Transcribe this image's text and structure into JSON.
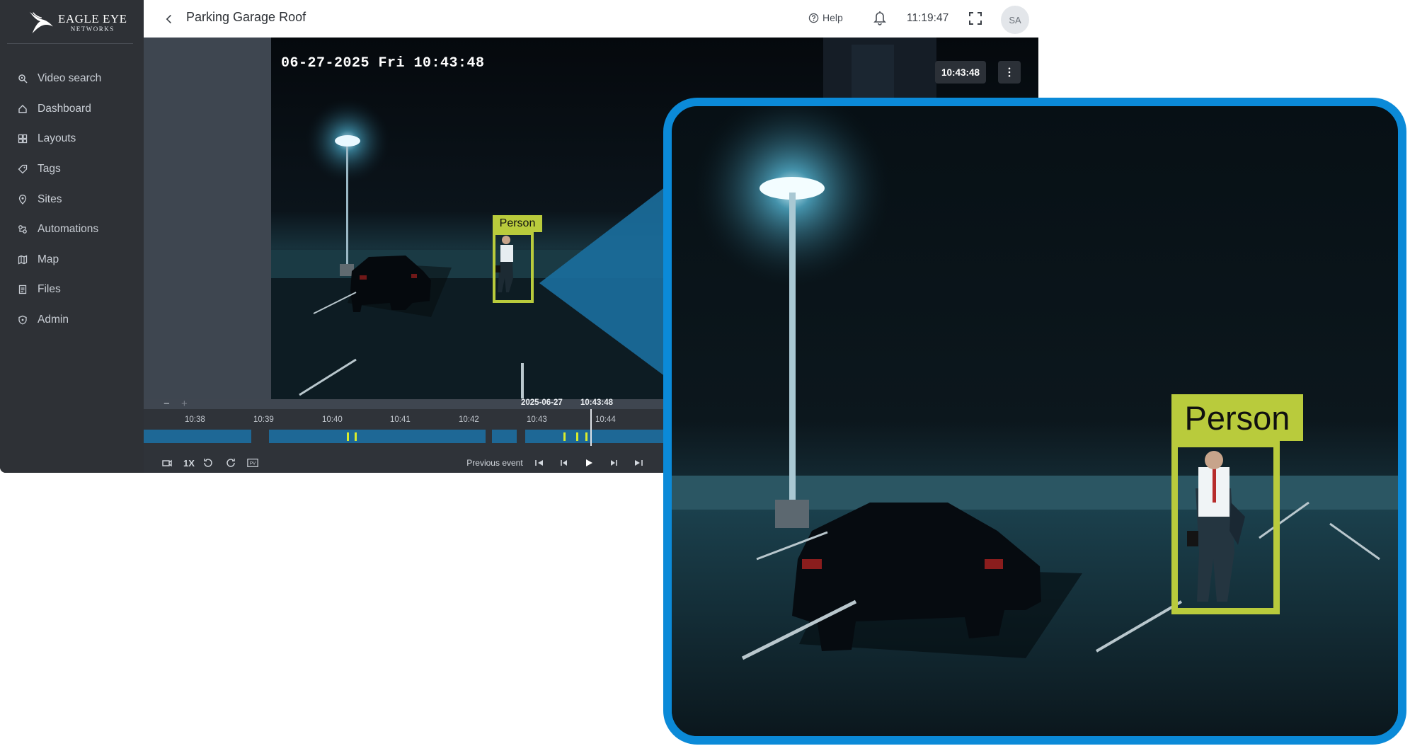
{
  "app": {
    "logo": {
      "main": "EAGLE EYE",
      "sub": "NETWORKS"
    },
    "camera_title": "Parking Garage Roof",
    "help_label": "Help",
    "clock": "11:19:47",
    "avatar_initials": "SA"
  },
  "sidebar": {
    "items": [
      {
        "label": "Video search",
        "icon": "search-icon"
      },
      {
        "label": "Dashboard",
        "icon": "home-icon"
      },
      {
        "label": "Layouts",
        "icon": "layouts-icon"
      },
      {
        "label": "Tags",
        "icon": "tag-icon"
      },
      {
        "label": "Sites",
        "icon": "location-pin-icon"
      },
      {
        "label": "Automations",
        "icon": "automation-icon"
      },
      {
        "label": "Map",
        "icon": "map-icon"
      },
      {
        "label": "Files",
        "icon": "files-icon"
      },
      {
        "label": "Admin",
        "icon": "shield-icon"
      }
    ]
  },
  "video": {
    "osd_timestamp": "06-27-2025 Fri 10:43:48",
    "current_time": "10:43:48",
    "detection_label": "Person"
  },
  "timeline": {
    "date": "2025-06-27",
    "cursor_time": "10:43:48",
    "ticks": [
      "10:38",
      "10:39",
      "10:40",
      "10:41",
      "10:42",
      "10:43",
      "10:44"
    ],
    "speed": "1X",
    "previous_event_label": "Previous event"
  },
  "zoom_view": {
    "detection_label": "Person"
  },
  "colors": {
    "accent": "#0b8ad8",
    "detection": "#b9cb3c",
    "timeline_segment": "#1e6896",
    "event_marker": "#d9ec2c"
  }
}
